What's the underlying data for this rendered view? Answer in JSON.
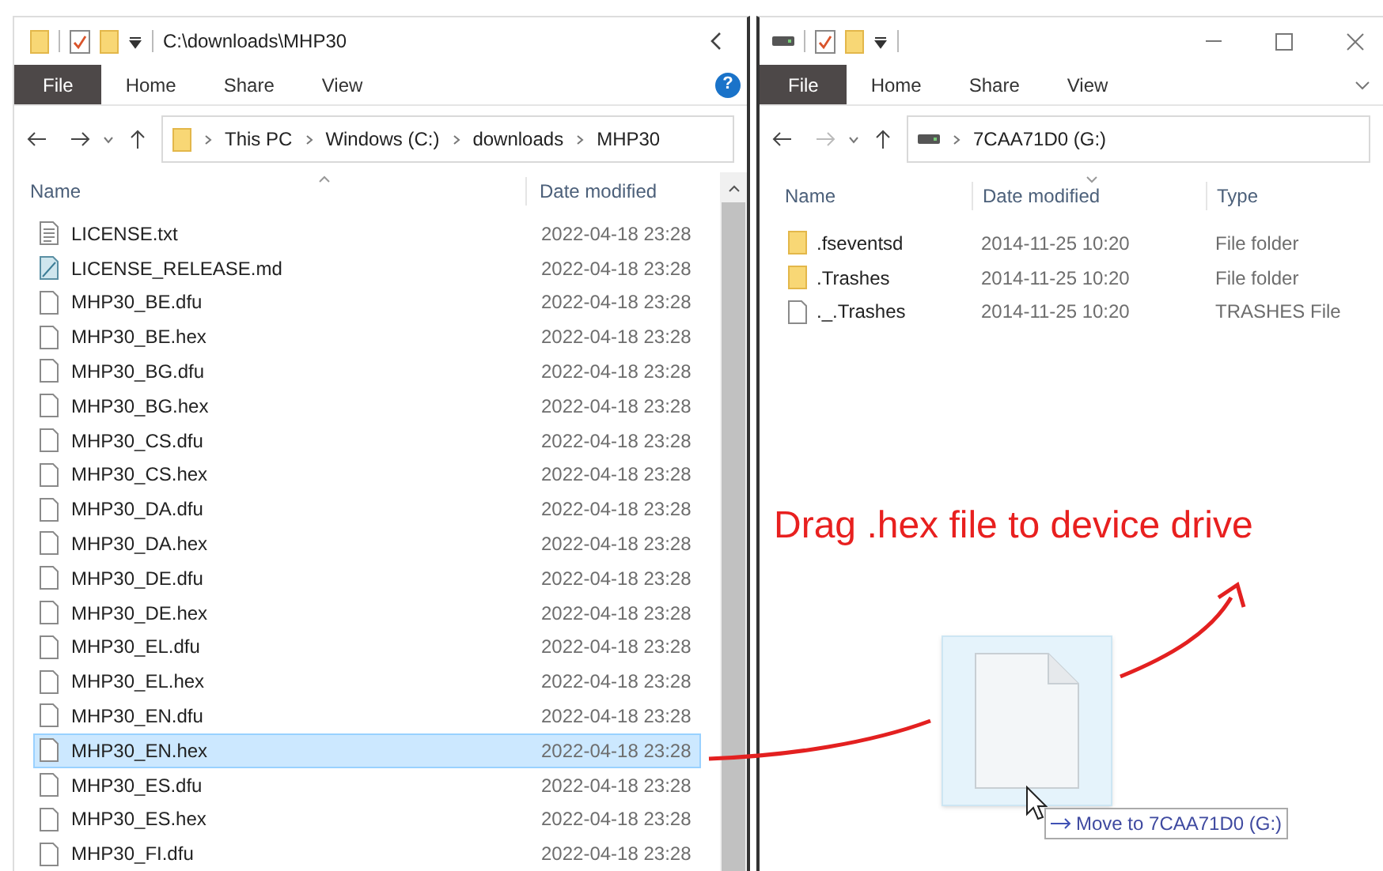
{
  "left_window": {
    "title": "C:\\downloads\\MHP30",
    "file_tab": "File",
    "tabs": [
      "Home",
      "Share",
      "View"
    ],
    "help": "?",
    "breadcrumb": [
      "This PC",
      "Windows (C:)",
      "downloads",
      "MHP30"
    ],
    "columns": [
      "Name",
      "Date modified"
    ],
    "rows": [
      {
        "name": "LICENSE.txt",
        "date": "2022-04-18 23:28",
        "kind": "text",
        "selected": false
      },
      {
        "name": "LICENSE_RELEASE.md",
        "date": "2022-04-18 23:28",
        "kind": "doc",
        "selected": false
      },
      {
        "name": "MHP30_BE.dfu",
        "date": "2022-04-18 23:28",
        "kind": "file",
        "selected": false
      },
      {
        "name": "MHP30_BE.hex",
        "date": "2022-04-18 23:28",
        "kind": "file",
        "selected": false
      },
      {
        "name": "MHP30_BG.dfu",
        "date": "2022-04-18 23:28",
        "kind": "file",
        "selected": false
      },
      {
        "name": "MHP30_BG.hex",
        "date": "2022-04-18 23:28",
        "kind": "file",
        "selected": false
      },
      {
        "name": "MHP30_CS.dfu",
        "date": "2022-04-18 23:28",
        "kind": "file",
        "selected": false
      },
      {
        "name": "MHP30_CS.hex",
        "date": "2022-04-18 23:28",
        "kind": "file",
        "selected": false
      },
      {
        "name": "MHP30_DA.dfu",
        "date": "2022-04-18 23:28",
        "kind": "file",
        "selected": false
      },
      {
        "name": "MHP30_DA.hex",
        "date": "2022-04-18 23:28",
        "kind": "file",
        "selected": false
      },
      {
        "name": "MHP30_DE.dfu",
        "date": "2022-04-18 23:28",
        "kind": "file",
        "selected": false
      },
      {
        "name": "MHP30_DE.hex",
        "date": "2022-04-18 23:28",
        "kind": "file",
        "selected": false
      },
      {
        "name": "MHP30_EL.dfu",
        "date": "2022-04-18 23:28",
        "kind": "file",
        "selected": false
      },
      {
        "name": "MHP30_EL.hex",
        "date": "2022-04-18 23:28",
        "kind": "file",
        "selected": false
      },
      {
        "name": "MHP30_EN.dfu",
        "date": "2022-04-18 23:28",
        "kind": "file",
        "selected": false
      },
      {
        "name": "MHP30_EN.hex",
        "date": "2022-04-18 23:28",
        "kind": "file",
        "selected": true
      },
      {
        "name": "MHP30_ES.dfu",
        "date": "2022-04-18 23:28",
        "kind": "file",
        "selected": false
      },
      {
        "name": "MHP30_ES.hex",
        "date": "2022-04-18 23:28",
        "kind": "file",
        "selected": false
      },
      {
        "name": "MHP30_FI.dfu",
        "date": "2022-04-18 23:28",
        "kind": "file",
        "selected": false
      }
    ]
  },
  "right_window": {
    "file_tab": "File",
    "tabs": [
      "Home",
      "Share",
      "View"
    ],
    "breadcrumb": [
      "7CAA71D0 (G:)"
    ],
    "columns": [
      "Name",
      "Date modified",
      "Type"
    ],
    "rows": [
      {
        "name": ".fseventsd",
        "date": "2014-11-25 10:20",
        "type": "File folder",
        "kind": "folder"
      },
      {
        "name": ".Trashes",
        "date": "2014-11-25 10:20",
        "type": "File folder",
        "kind": "folder"
      },
      {
        "name": "._.Trashes",
        "date": "2014-11-25 10:20",
        "type": "TRASHES File",
        "kind": "file"
      }
    ]
  },
  "annotation": "Drag .hex file to device drive",
  "drag_tooltip": "Move to 7CAA71D0 (G:)"
}
